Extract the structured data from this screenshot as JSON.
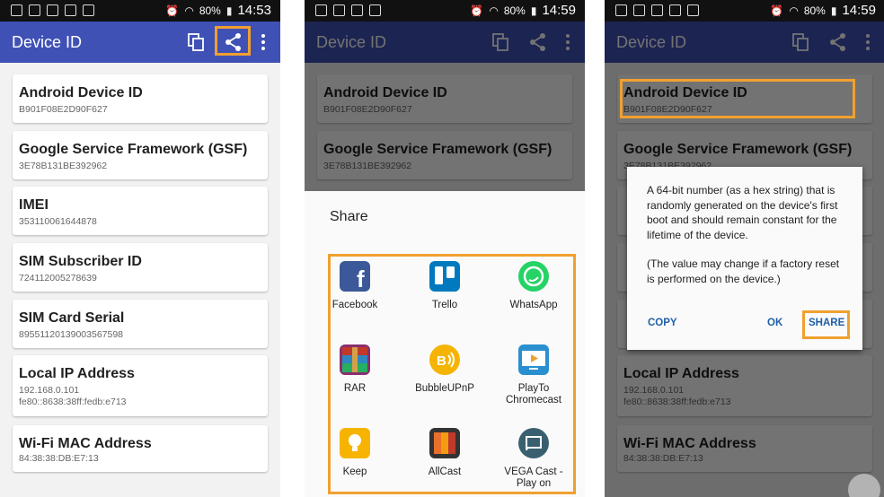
{
  "status": {
    "screen1": {
      "battery": "80%",
      "time": "14:53"
    },
    "screen2": {
      "battery": "80%",
      "time": "14:59"
    },
    "screen3": {
      "battery": "80%",
      "time": "14:59"
    }
  },
  "app": {
    "title": "Device ID"
  },
  "toolbar": {
    "icons": [
      "copy-icon",
      "share-icon",
      "more-vert-icon"
    ]
  },
  "cards": [
    {
      "title": "Android Device ID",
      "value": "B901F08E2D90F627"
    },
    {
      "title": "Google Service Framework (GSF)",
      "value": "3E78B131BE392962"
    },
    {
      "title": "IMEI",
      "value": "353110061644878"
    },
    {
      "title": "SIM Subscriber ID",
      "value": "724112005278639"
    },
    {
      "title": "SIM Card Serial",
      "value": "89551120139003567598"
    },
    {
      "title": "Local IP Address",
      "value": "192.168.0.101\nfe80::8638:38ff:fedb:e713"
    },
    {
      "title": "Wi-Fi MAC Address",
      "value": "84:38:38:DB:E7:13"
    }
  ],
  "share": {
    "title": "Share",
    "apps": [
      {
        "label": "Facebook",
        "icon": "facebook-icon",
        "color": "#3b5998"
      },
      {
        "label": "Trello",
        "icon": "trello-icon",
        "color": "#0079bf"
      },
      {
        "label": "WhatsApp",
        "icon": "whatsapp-icon",
        "color": "#25d366"
      },
      {
        "label": "RAR",
        "icon": "rar-icon",
        "color": "#8a2e6e"
      },
      {
        "label": "BubbleUPnP",
        "icon": "bubbleupnp-icon",
        "color": "#f5b400"
      },
      {
        "label": "PlayTo\nChromecast",
        "icon": "playto-chromecast-icon",
        "color": "#2a8fd0"
      },
      {
        "label": "Keep",
        "icon": "keep-icon",
        "color": "#f6b400"
      },
      {
        "label": "AllCast",
        "icon": "allcast-icon",
        "color": "#e8702a"
      },
      {
        "label": "VEGA Cast -\nPlay on",
        "icon": "vega-cast-icon",
        "color": "#3a6070"
      }
    ]
  },
  "dialog": {
    "text": "A 64-bit number (as a hex string) that is randomly generated on the device's first boot and should remain constant for the lifetime of the device.",
    "note": "(The value may change if a factory reset is performed on the device.)",
    "copy": "COPY",
    "ok": "OK",
    "share": "SHARE"
  },
  "colors": {
    "appbar": "#3f51b5",
    "highlight": "#f0a030",
    "dialog_button": "#1f5fa8"
  }
}
